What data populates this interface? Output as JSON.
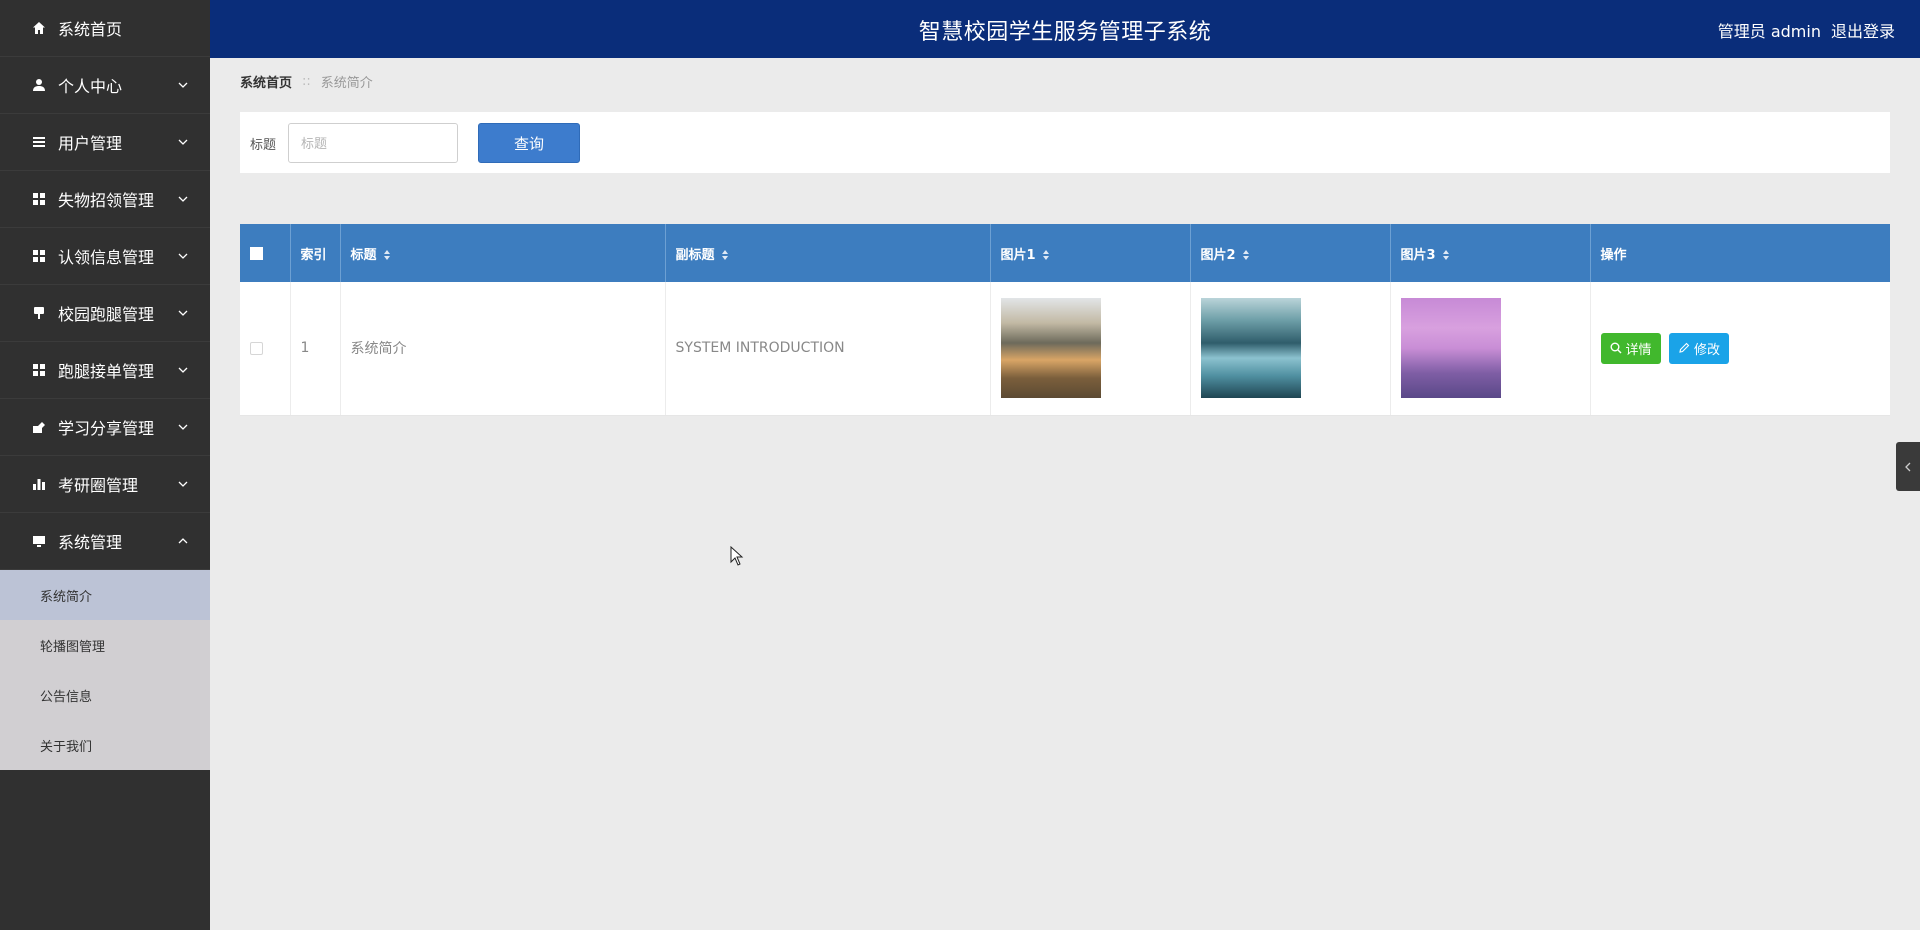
{
  "header": {
    "title": "智慧校园学生服务管理子系统",
    "user": "管理员 admin",
    "logout": "退出登录"
  },
  "sidebar": {
    "items": [
      {
        "label": "系统首页",
        "icon": "home-icon"
      },
      {
        "label": "个人中心",
        "icon": "user-icon"
      },
      {
        "label": "用户管理",
        "icon": "list-icon"
      },
      {
        "label": "失物招领管理",
        "icon": "grid-icon"
      },
      {
        "label": "认领信息管理",
        "icon": "grid-icon"
      },
      {
        "label": "校园跑腿管理",
        "icon": "pin-icon"
      },
      {
        "label": "跑腿接单管理",
        "icon": "grid-icon"
      },
      {
        "label": "学习分享管理",
        "icon": "share-icon"
      },
      {
        "label": "考研圈管理",
        "icon": "bar-chart-icon"
      },
      {
        "label": "系统管理",
        "icon": "monitor-icon"
      }
    ],
    "submenu": [
      {
        "label": "系统简介"
      },
      {
        "label": "轮播图管理"
      },
      {
        "label": "公告信息"
      },
      {
        "label": "关于我们"
      }
    ]
  },
  "breadcrumb": {
    "home": "系统首页",
    "separator": "::",
    "current": "系统简介"
  },
  "search": {
    "label": "标题",
    "placeholder": "标题",
    "value": "",
    "button": "查询"
  },
  "table": {
    "headers": [
      "索引",
      "标题",
      "副标题",
      "图片1",
      "图片2",
      "图片3",
      "操作"
    ],
    "rows": [
      {
        "index": "1",
        "title": "系统简介",
        "subtitle": "SYSTEM INTRODUCTION",
        "detail_button": "详情",
        "edit_button": "修改"
      }
    ]
  },
  "colors": {
    "header_bg": "#0a2d7a",
    "sidebar_bg": "#303030",
    "table_header_bg": "#3d7dbf",
    "search_button_bg": "#3d7ccd",
    "detail_button_bg": "#41b82d",
    "edit_button_bg": "#1aa3e8"
  }
}
